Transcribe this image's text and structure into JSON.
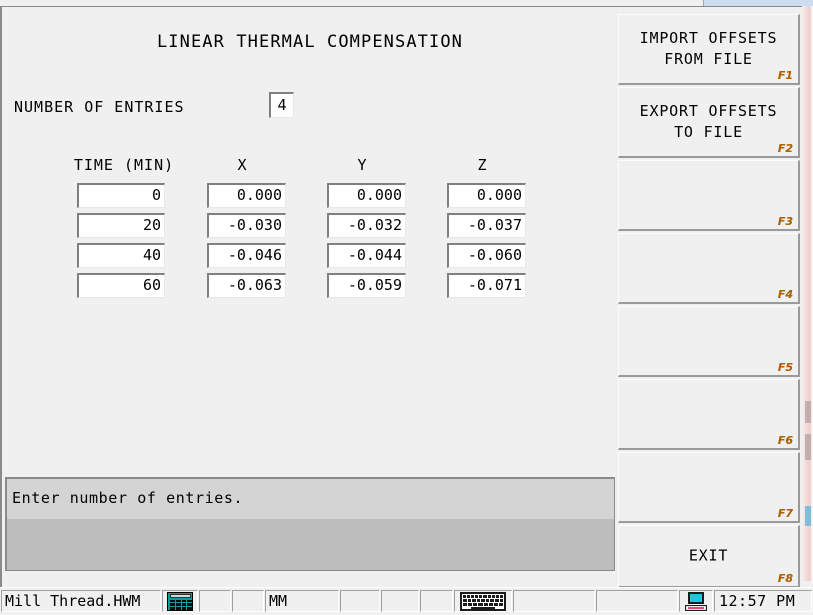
{
  "window": {
    "title": "LINEAR THERMAL COMPENSATION"
  },
  "form": {
    "entries_label": "NUMBER OF ENTRIES",
    "entries_value": "4"
  },
  "table": {
    "headers": [
      "TIME (MIN)",
      "X",
      "Y",
      "Z"
    ],
    "rows": [
      {
        "time": "0",
        "x": "0.000",
        "y": "0.000",
        "z": "0.000"
      },
      {
        "time": "20",
        "x": "-0.030",
        "y": "-0.032",
        "z": "-0.037"
      },
      {
        "time": "40",
        "x": "-0.046",
        "y": "-0.044",
        "z": "-0.060"
      },
      {
        "time": "60",
        "x": "-0.063",
        "y": "-0.059",
        "z": "-0.071"
      }
    ]
  },
  "messages": {
    "prompt": "Enter number of entries.",
    "secondary": ""
  },
  "sidebar": {
    "buttons": [
      {
        "label": "IMPORT OFFSETS\nFROM FILE",
        "key": "F1"
      },
      {
        "label": "EXPORT OFFSETS\nTO FILE",
        "key": "F2"
      },
      {
        "label": "",
        "key": "F3"
      },
      {
        "label": "",
        "key": "F4"
      },
      {
        "label": "",
        "key": "F5"
      },
      {
        "label": "",
        "key": "F6"
      },
      {
        "label": "",
        "key": "F7"
      },
      {
        "label": "EXIT",
        "key": "F8"
      }
    ]
  },
  "statusbar": {
    "file_name": "Mill Thread.HWM",
    "calculator_icon": "calculator-icon",
    "cell_blank_1": "",
    "cell_blank_2": "",
    "units": "MM",
    "cell_blank_3": "",
    "cell_blank_4": "",
    "cell_blank_5": "",
    "keyboard_icon": "keyboard-icon",
    "cell_wide_1": "",
    "cell_wide_2": "",
    "computer_icon": "computer-icon",
    "clock": "12:57 PM"
  },
  "colors": {
    "face": "#f0f0f0",
    "field": "#ffffff",
    "msg_top": "#d4d4d4",
    "msg_bottom": "#bdbdbd",
    "fkey_tag": "#b06000",
    "calc_icon": "#109a98",
    "pc_screen": "#19c9e0"
  }
}
